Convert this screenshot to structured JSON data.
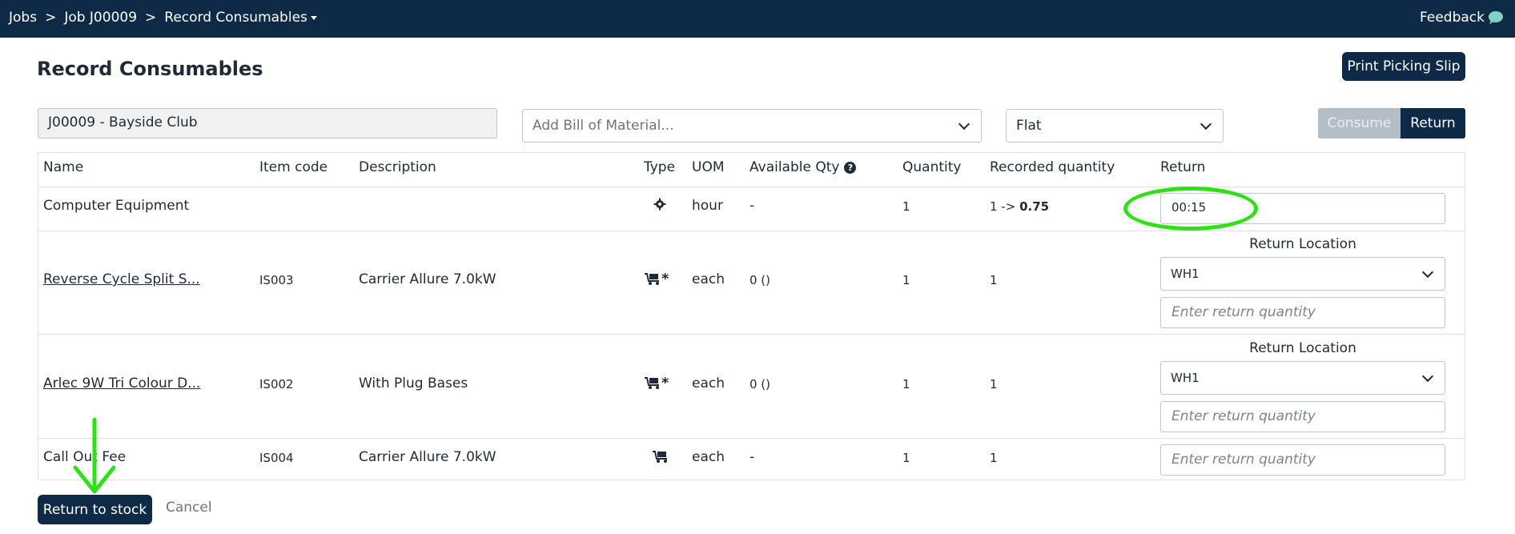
{
  "breadcrumb": {
    "items": [
      "Jobs",
      "Job J00009",
      "Record Consumables"
    ],
    "separator": ">"
  },
  "feedback_label": "Feedback",
  "page_title": "Record Consumables",
  "print_button": "Print Picking Slip",
  "job_field": "J00009 - Bayside Club",
  "bom_select": {
    "placeholder": "Add Bill of Material..."
  },
  "rate_select": {
    "value": "Flat"
  },
  "mode_toggle": {
    "consume": "Consume",
    "return": "Return",
    "active": "Return"
  },
  "table": {
    "headers": {
      "name": "Name",
      "item_code": "Item code",
      "description": "Description",
      "type": "Type",
      "uom": "UOM",
      "available_qty": "Available Qty",
      "quantity": "Quantity",
      "recorded_quantity": "Recorded quantity",
      "return": "Return"
    },
    "rows": [
      {
        "name": "Computer Equipment",
        "item_code": "",
        "description": "",
        "type_icon": "gear-icon",
        "uom": "hour",
        "available": "-",
        "quantity": "1",
        "recorded_from": "1 ->",
        "recorded_to": "0.75",
        "return_value": "00:15"
      },
      {
        "name": "Reverse Cycle Split S...",
        "item_code": "IS003",
        "description": "Carrier Allure 7.0kW",
        "type_icon": "trolley-serial-icon",
        "uom": "each",
        "available": "0 ()",
        "quantity": "1",
        "recorded": "1",
        "return_location_label": "Return Location",
        "return_location": "WH1",
        "return_placeholder": "Enter return quantity"
      },
      {
        "name": "Arlec 9W Tri Colour D...",
        "item_code": "IS002",
        "description": "With Plug Bases",
        "type_icon": "trolley-serial-icon",
        "uom": "each",
        "available": "0 ()",
        "quantity": "1",
        "recorded": "1",
        "return_location_label": "Return Location",
        "return_location": "WH1",
        "return_placeholder": "Enter return quantity"
      },
      {
        "name": "Call Out Fee",
        "item_code": "IS004",
        "description": "Carrier Allure 7.0kW",
        "type_icon": "trolley-icon",
        "uom": "each",
        "available": "-",
        "quantity": "1",
        "recorded": "1",
        "return_placeholder": "Enter return quantity"
      }
    ]
  },
  "footer": {
    "return_button": "Return to stock",
    "cancel": "Cancel"
  },
  "colors": {
    "nav": "#0e2a47",
    "annotation": "#2ee015",
    "toggle_inactive": "#b4bec6"
  }
}
